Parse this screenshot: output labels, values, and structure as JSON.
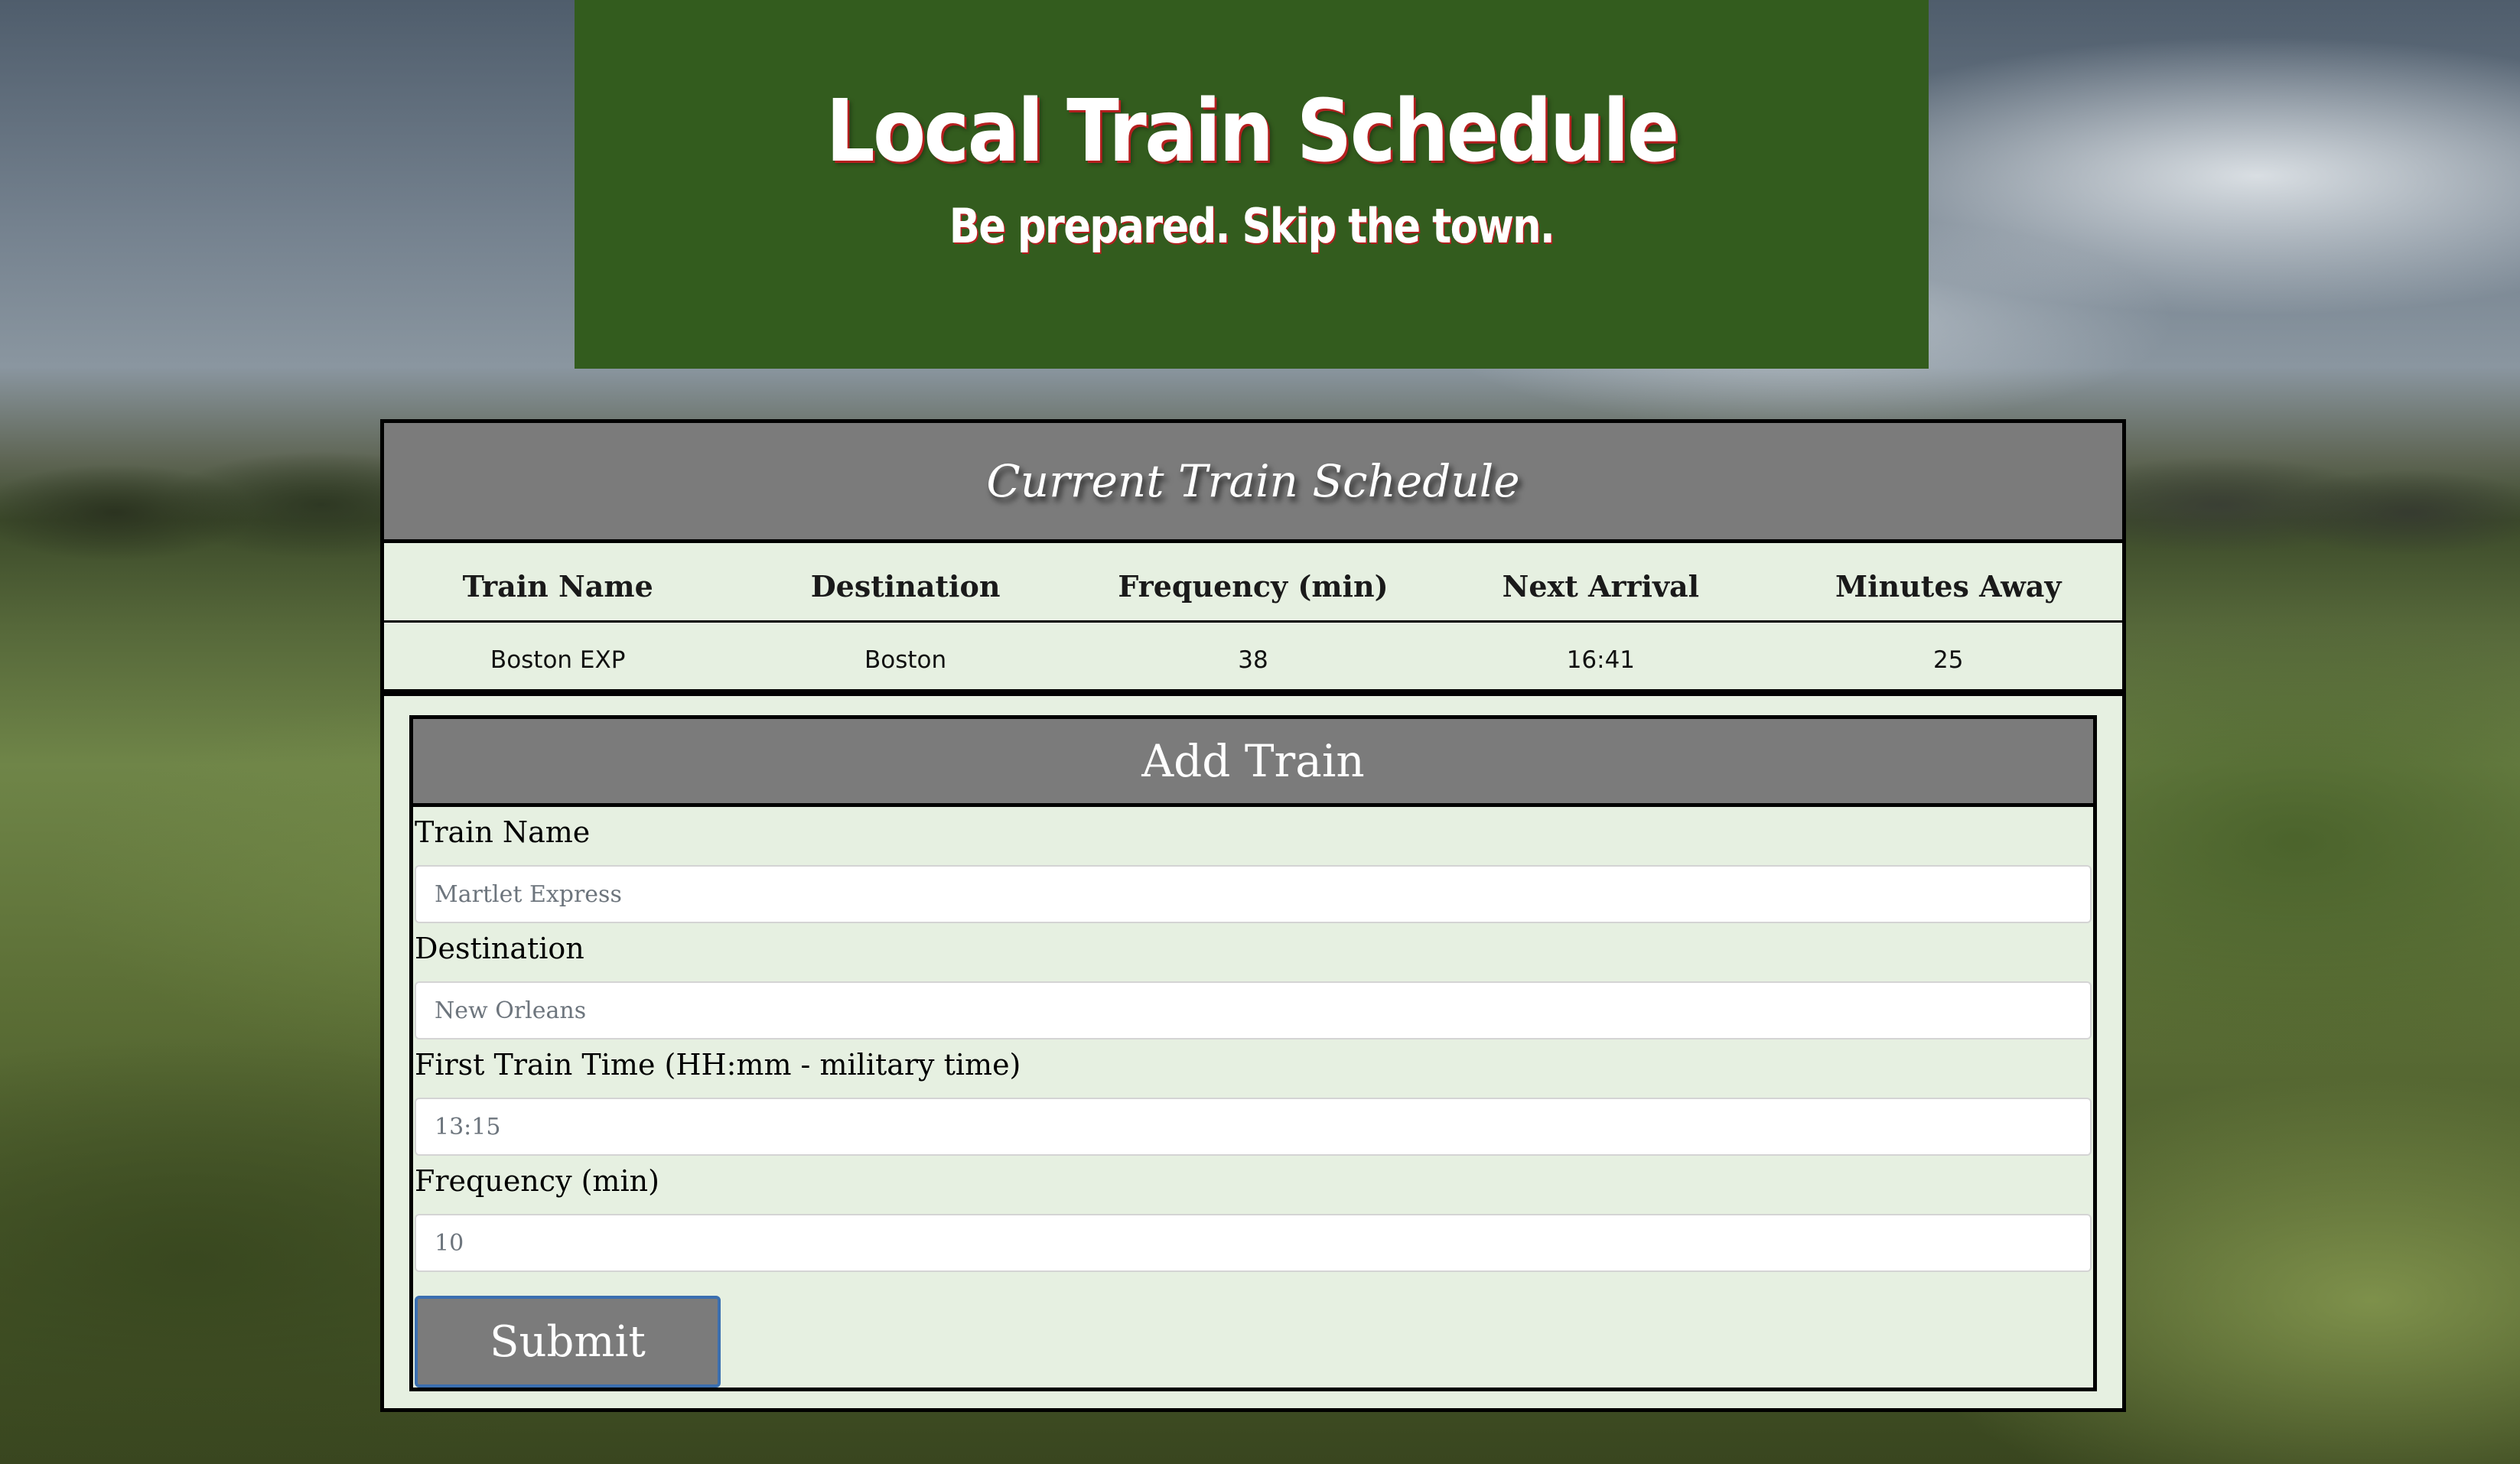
{
  "header": {
    "title": "Local Train Schedule",
    "tagline": "Be prepared. Skip the town."
  },
  "schedule": {
    "heading": "Current Train Schedule",
    "columns": [
      "Train Name",
      "Destination",
      "Frequency (min)",
      "Next Arrival",
      "Minutes Away"
    ],
    "rows": [
      [
        "Boston EXP",
        "Boston",
        "38",
        "16:41",
        "25"
      ]
    ]
  },
  "add_train": {
    "heading": "Add Train",
    "fields": [
      {
        "label": "Train Name",
        "placeholder": "Martlet Express"
      },
      {
        "label": "Destination",
        "placeholder": "New Orleans"
      },
      {
        "label": "First Train Time (HH:mm - military time)",
        "placeholder": "13:15"
      },
      {
        "label": "Frequency (min)",
        "placeholder": "10"
      }
    ],
    "submit_label": "Submit"
  },
  "colors": {
    "header_bg": "#335c1e",
    "panel_heading_bg": "#7b7b7b",
    "panel_bg": "#e6f0e1",
    "title_shadow": "#b51f1f"
  }
}
